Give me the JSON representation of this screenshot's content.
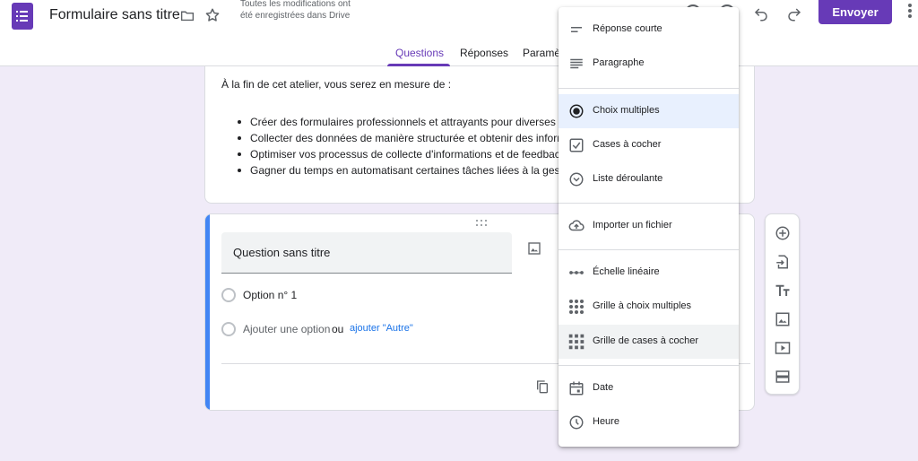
{
  "header": {
    "title": "Formulaire sans titre",
    "save_status": "Toutes les modifications ont été enregistrées dans Drive",
    "send_label": "Envoyer"
  },
  "tabs": [
    {
      "label": "Questions"
    },
    {
      "label": "Réponses"
    },
    {
      "label": "Paramè"
    }
  ],
  "description": {
    "intro": "À la fin de cet atelier, vous serez en mesure de :",
    "bullets": [
      "Créer des formulaires professionnels et attrayants pour diverses ap",
      "Collecter des données de manière structurée et obtenir des inform",
      "Optimiser vos processus de collecte d'informations et de feedback",
      "Gagner du temps en automatisant certaines tâches liées à la gesti"
    ]
  },
  "question": {
    "title": "Question sans titre",
    "option1": "Option n° 1",
    "add_option": "Ajouter une option",
    "or": "ou",
    "add_other": "ajouter \"Autre\""
  },
  "menu": {
    "items": [
      {
        "label": "Réponse courte",
        "icon": "short-answer-icon"
      },
      {
        "label": "Paragraphe",
        "icon": "paragraph-icon"
      },
      {
        "label": "Choix multiples",
        "icon": "radio-icon"
      },
      {
        "label": "Cases à cocher",
        "icon": "checkbox-icon"
      },
      {
        "label": "Liste déroulante",
        "icon": "dropdown-icon"
      },
      {
        "label": "Importer un fichier",
        "icon": "cloud-upload-icon"
      },
      {
        "label": "Échelle linéaire",
        "icon": "linear-scale-icon"
      },
      {
        "label": "Grille à choix multiples",
        "icon": "grid-dots-icon"
      },
      {
        "label": "Grille de cases à cocher",
        "icon": "grid-squares-icon"
      },
      {
        "label": "Date",
        "icon": "calendar-icon"
      },
      {
        "label": "Heure",
        "icon": "clock-icon"
      }
    ],
    "selected": "Choix multiples",
    "hovered": "Grille de cases à cocher"
  },
  "colors": {
    "accent": "#673ab7",
    "background": "#f0ebf8",
    "link": "#1a73e8",
    "question_focus": "#4285f4"
  }
}
